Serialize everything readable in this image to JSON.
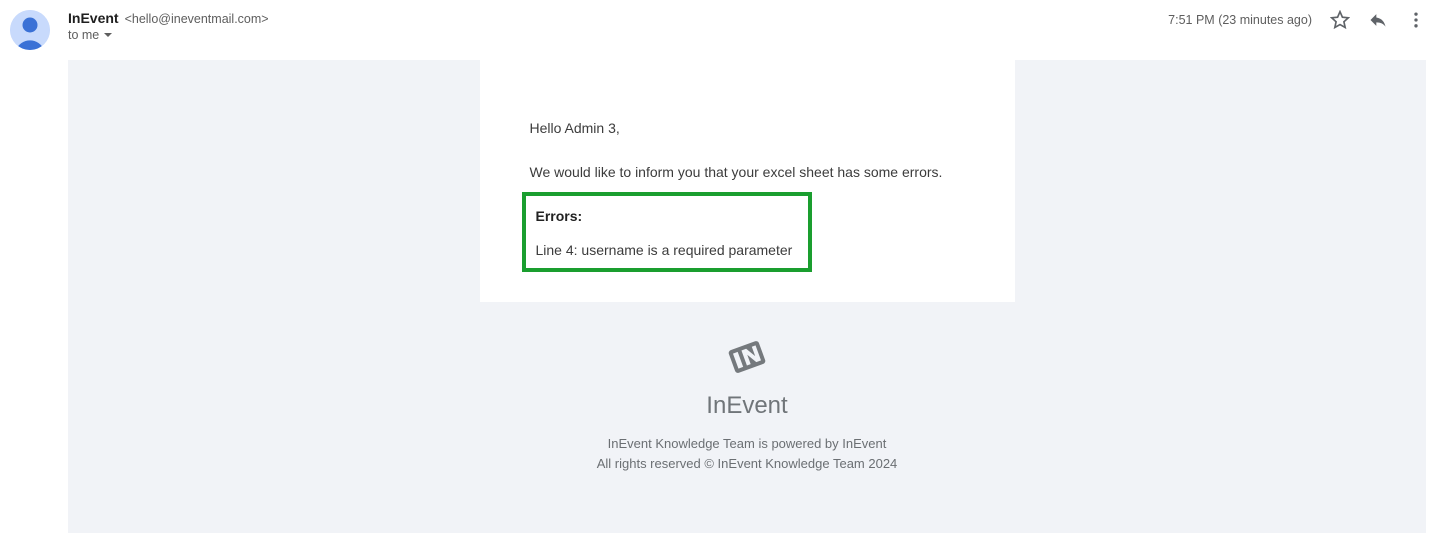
{
  "header": {
    "sender_name": "InEvent",
    "sender_email": "<hello@ineventmail.com>",
    "recipient_line": "to me",
    "timestamp": "7:51 PM (23 minutes ago)"
  },
  "body": {
    "greeting": "Hello Admin 3,",
    "info": "We would like to inform you that your excel sheet has some errors.",
    "errors_heading": "Errors:",
    "errors": [
      "Line 4: username is a required parameter"
    ]
  },
  "footer": {
    "brand": "InEvent",
    "line1": "InEvent Knowledge Team is powered by InEvent",
    "line2": "All rights reserved © InEvent Knowledge Team 2024"
  }
}
